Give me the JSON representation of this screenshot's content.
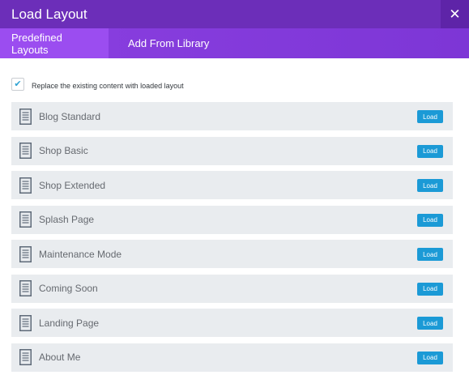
{
  "modal": {
    "title": "Load Layout",
    "close_icon": "close-icon",
    "colors": {
      "header": "#6c2eb9",
      "tabs": "#8a3fe0",
      "active_tab": "#9b4df0",
      "load_button": "#1b9ad6",
      "item_bg": "#e9ecef"
    }
  },
  "tabs": [
    {
      "label": "Predefined Layouts",
      "active": true
    },
    {
      "label": "Add From Library",
      "active": false
    }
  ],
  "replace_option": {
    "label": "Replace the existing content with loaded layout",
    "checked": true
  },
  "layouts": [
    {
      "name": "Blog Standard",
      "button": "Load"
    },
    {
      "name": "Shop Basic",
      "button": "Load"
    },
    {
      "name": "Shop Extended",
      "button": "Load"
    },
    {
      "name": "Splash Page",
      "button": "Load"
    },
    {
      "name": "Maintenance Mode",
      "button": "Load"
    },
    {
      "name": "Coming Soon",
      "button": "Load"
    },
    {
      "name": "Landing Page",
      "button": "Load"
    },
    {
      "name": "About Me",
      "button": "Load"
    }
  ]
}
